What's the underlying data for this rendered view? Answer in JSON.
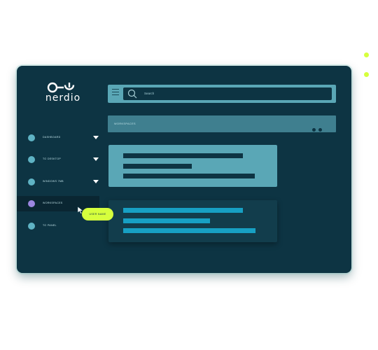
{
  "brand": {
    "name": "nerdio"
  },
  "sidebar": {
    "items": [
      {
        "label": "DASHBOARD",
        "has_chevron": true,
        "active": false
      },
      {
        "label": "TO DESKTOP",
        "has_chevron": true,
        "active": false
      },
      {
        "label": "WINDOWS 7MB",
        "has_chevron": true,
        "active": false
      },
      {
        "label": "WORKSPACES",
        "has_chevron": false,
        "active": true
      },
      {
        "label": "TO PANEL",
        "has_chevron": false,
        "active": false
      }
    ]
  },
  "topbar": {
    "search_placeholder": "Search"
  },
  "workspaces_bar": {
    "label": "WORKSPACES"
  },
  "tooltip": {
    "label": "USER NAME"
  },
  "colors": {
    "window_bg": "#0d3443",
    "accent_teal": "#5aa7b6",
    "accent_lime": "#d6ff3d",
    "active_dot": "#9c86e0",
    "bar_blue": "#17a0c4"
  },
  "icons": [
    "power-logo-icon",
    "menu-icon",
    "search-icon",
    "chevron-down-icon",
    "more-dots-icon",
    "cursor-icon"
  ]
}
